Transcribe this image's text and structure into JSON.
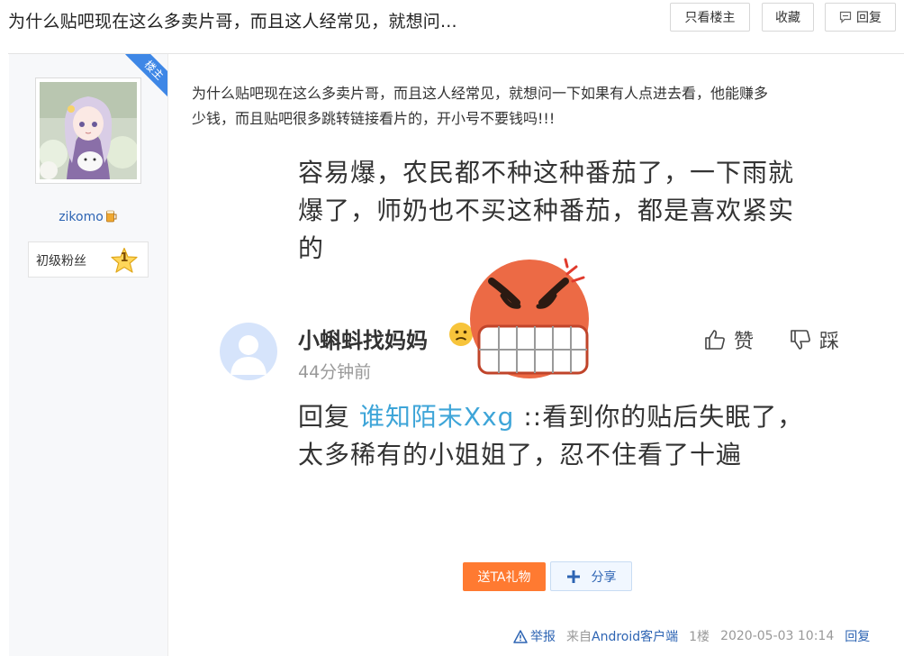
{
  "header": {
    "title": "为什么贴吧现在这么多卖片哥，而且这人经常见，就想问...",
    "only_op_label": "只看楼主",
    "favorite_label": "收藏",
    "reply_label": "回复"
  },
  "author": {
    "op_badge": "楼主",
    "username": "zikomo",
    "level_name": "初级粉丝",
    "level_number": "1"
  },
  "post": {
    "text_line1": "为什么贴吧现在这么多卖片哥，而且这人经常见，就想问一下如果有人点进去看，他能赚多",
    "text_line2": "少钱，而且贴吧很多跳转链接看片的，开小号不要钱吗!!!"
  },
  "screenshot": {
    "line1": "容易爆，农民都不种这种番茄了，一下雨就",
    "line2": "爆了，师奶也不买这种番茄，都是喜欢紧实",
    "line3": "的",
    "comment_user": "小蝌蚪找妈妈",
    "comment_time": "44分钟前",
    "like_label": "赞",
    "dislike_label": "踩",
    "reply_prefix": "回复 ",
    "reply_target": "谁知陌末Xxg",
    "reply_rest": " ::看到你的贴后失眠了，",
    "reply_line2": "太多稀有的小姐姐了，忍不住看了十遍"
  },
  "actions": {
    "gift_label": "送TA礼物",
    "share_label": "分享"
  },
  "meta": {
    "report_label": "举报",
    "from_prefix": "来自",
    "client": "Android客户端",
    "floor": "1楼",
    "time": "2020-05-03 10:14",
    "reply_label": "回复"
  },
  "colors": {
    "link_blue": "#2d64b3",
    "op_ribbon": "#3e87e6",
    "gift_orange": "#ff7a31",
    "mention_blue": "#3ea5d8"
  }
}
